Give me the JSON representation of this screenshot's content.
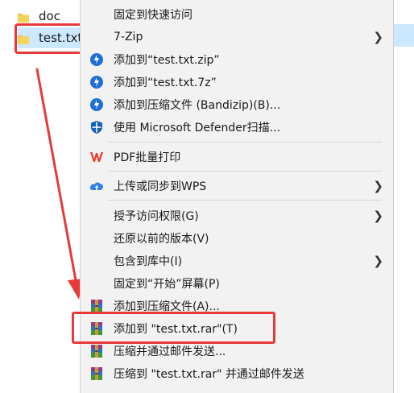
{
  "explorer": {
    "files": [
      {
        "name": "doc"
      },
      {
        "name": "test.txt"
      }
    ]
  },
  "menu": {
    "items": [
      {
        "label": "固定到快速访问",
        "icon": "none",
        "submenu": false
      },
      {
        "label": "7-Zip",
        "icon": "none",
        "submenu": true
      },
      {
        "label": "添加到“test.txt.zip”",
        "icon": "bandizip-icon",
        "submenu": false
      },
      {
        "label": "添加到“test.txt.7z”",
        "icon": "bandizip-icon",
        "submenu": false
      },
      {
        "label": "添加到压缩文件 (Bandizip)(B)...",
        "icon": "bandizip-icon",
        "submenu": false
      },
      {
        "label": "使用 Microsoft Defender扫描...",
        "icon": "defender-shield-icon",
        "submenu": false
      },
      {
        "label": "PDF批量打印",
        "icon": "wps-pdf-icon",
        "submenu": false
      },
      {
        "label": "上传或同步到WPS",
        "icon": "wps-cloud-icon",
        "submenu": true
      },
      {
        "label": "授予访问权限(G)",
        "icon": "none",
        "submenu": true
      },
      {
        "label": "还原以前的版本(V)",
        "icon": "none",
        "submenu": false
      },
      {
        "label": "包含到库中(I)",
        "icon": "none",
        "submenu": true
      },
      {
        "label": "固定到“开始”屏幕(P)",
        "icon": "none",
        "submenu": false
      },
      {
        "label": "添加到压缩文件(A)...",
        "icon": "winrar-icon",
        "submenu": false
      },
      {
        "label": "添加到 \"test.txt.rar\"(T)",
        "icon": "winrar-icon",
        "submenu": false
      },
      {
        "label": "压缩并通过邮件发送...",
        "icon": "winrar-icon",
        "submenu": false
      },
      {
        "label": "压缩到 \"test.txt.rar\" 并通过邮件发送",
        "icon": "winrar-icon",
        "submenu": false
      }
    ]
  },
  "colors": {
    "annotation_red": "#e8393a",
    "selection_blue": "#cce8ff",
    "menu_bg": "#f2f2f2",
    "bandizip_blue": "#1e6fd9",
    "wps_red": "#e8392d"
  }
}
